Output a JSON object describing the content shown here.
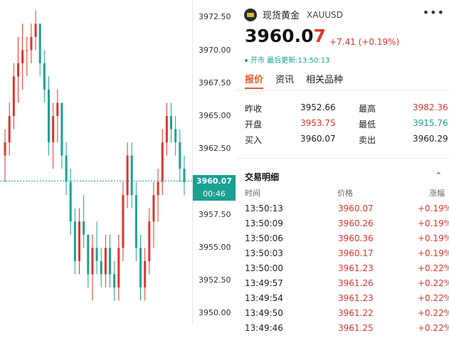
{
  "chart": {
    "y_ticks": [
      "3972.50",
      "3970.00",
      "3967.50",
      "3965.00",
      "3962.50",
      "3957.50",
      "3955.00",
      "3952.50",
      "3950.00"
    ],
    "current_price": "3960.07",
    "countdown": "00:46",
    "up_color": "#e0342b",
    "down_color": "#1aa192",
    "candles": [
      [
        3962,
        3964,
        3960,
        3963
      ],
      [
        3963,
        3966,
        3962,
        3965
      ],
      [
        3965,
        3969,
        3964,
        3968
      ],
      [
        3968,
        3971,
        3966,
        3969
      ],
      [
        3969,
        3972,
        3967,
        3970
      ],
      [
        3970,
        3971,
        3968,
        3970
      ],
      [
        3970,
        3972,
        3969,
        3971
      ],
      [
        3971,
        3973,
        3970,
        3972
      ],
      [
        3972,
        3972,
        3968,
        3969
      ],
      [
        3969,
        3970,
        3966,
        3967
      ],
      [
        3967,
        3968,
        3962,
        3963
      ],
      [
        3963,
        3966,
        3961,
        3965
      ],
      [
        3965,
        3967,
        3963,
        3966
      ],
      [
        3966,
        3966,
        3961,
        3962
      ],
      [
        3962,
        3963,
        3959,
        3960
      ],
      [
        3960,
        3961,
        3956,
        3957
      ],
      [
        3957,
        3958,
        3953,
        3954
      ],
      [
        3954,
        3958,
        3953,
        3957
      ],
      [
        3957,
        3959,
        3955,
        3956
      ],
      [
        3956,
        3956,
        3952,
        3953
      ],
      [
        3953,
        3956,
        3951,
        3955
      ],
      [
        3955,
        3957,
        3953,
        3954
      ],
      [
        3954,
        3955,
        3952,
        3953
      ],
      [
        3953,
        3956,
        3952,
        3955
      ],
      [
        3955,
        3956,
        3952,
        3953
      ],
      [
        3953,
        3954,
        3951,
        3952
      ],
      [
        3952,
        3956,
        3951,
        3955
      ],
      [
        3955,
        3960,
        3954,
        3959
      ],
      [
        3959,
        3963,
        3958,
        3962
      ],
      [
        3962,
        3963,
        3958,
        3959
      ],
      [
        3959,
        3960,
        3954,
        3955
      ],
      [
        3955,
        3956,
        3951,
        3952
      ],
      [
        3952,
        3955,
        3951,
        3954
      ],
      [
        3954,
        3958,
        3953,
        3957
      ],
      [
        3957,
        3960,
        3955,
        3959
      ],
      [
        3959,
        3961,
        3957,
        3960
      ],
      [
        3960,
        3964,
        3959,
        3963
      ],
      [
        3963,
        3966,
        3962,
        3965
      ],
      [
        3965,
        3966,
        3963,
        3964
      ],
      [
        3964,
        3965,
        3962,
        3963
      ],
      [
        3963,
        3964,
        3960,
        3961
      ],
      [
        3961,
        3962,
        3959,
        3960
      ]
    ]
  },
  "header": {
    "name": "现货黄金",
    "symbol": "XAUUSD",
    "price_main": "3960.0",
    "price_last": "7",
    "change": "+7.41 (+0.19%)",
    "status": "开市 最后更新:13:50:13"
  },
  "tabs": [
    "报价",
    "资讯",
    "相关品种"
  ],
  "quotes": [
    {
      "l1": "昨收",
      "v1": "3952.66",
      "c1": "#222222",
      "l2": "最高",
      "v2": "3982.36",
      "c2": "#e0342b"
    },
    {
      "l1": "开盘",
      "v1": "3953.75",
      "c1": "#e0342b",
      "l2": "最低",
      "v2": "3915.76",
      "c2": "#1aa192"
    },
    {
      "l1": "买入",
      "v1": "3960.07",
      "c1": "#222222",
      "l2": "卖出",
      "v2": "3960.29",
      "c2": "#222222"
    }
  ],
  "trades": {
    "title": "交易明细",
    "headers": [
      "时间",
      "价格",
      "涨幅"
    ],
    "rows": [
      {
        "time": "13:50:13",
        "price": "3960.07",
        "change": "+0.19%"
      },
      {
        "time": "13:50:09",
        "price": "3960.26",
        "change": "+0.19%"
      },
      {
        "time": "13:50:06",
        "price": "3960.36",
        "change": "+0.19%"
      },
      {
        "time": "13:50:03",
        "price": "3960.17",
        "change": "+0.19%"
      },
      {
        "time": "13:50:00",
        "price": "3961.23",
        "change": "+0.22%"
      },
      {
        "time": "13:49:57",
        "price": "3961.26",
        "change": "+0.22%"
      },
      {
        "time": "13:49:54",
        "price": "3961.23",
        "change": "+0.22%"
      },
      {
        "time": "13:49:50",
        "price": "3961.22",
        "change": "+0.22%"
      },
      {
        "time": "13:49:46",
        "price": "3961.25",
        "change": "+0.22%"
      }
    ]
  }
}
